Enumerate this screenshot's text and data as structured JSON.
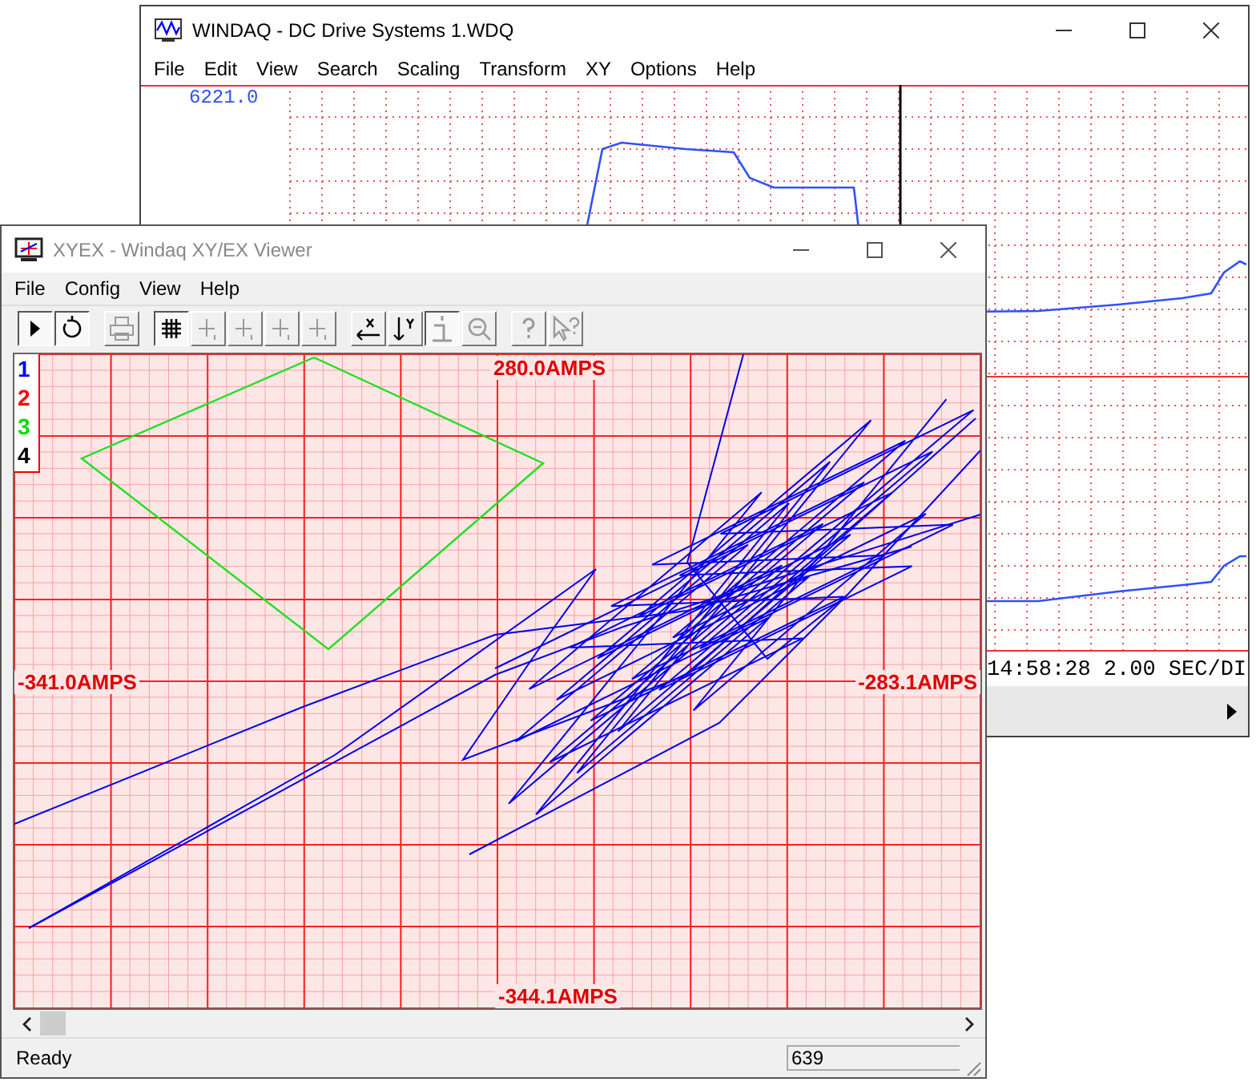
{
  "back_window": {
    "title": "WINDAQ - DC Drive Systems 1.WDQ",
    "active": true,
    "menu": [
      "File",
      "Edit",
      "View",
      "Search",
      "Scaling",
      "Transform",
      "XY",
      "Options",
      "Help"
    ],
    "scale_label": "6221.0",
    "time_label": "14:58:28 2.00 SEC/DI"
  },
  "front_window": {
    "title": "XYEX - Windaq XY/EX Viewer",
    "active": false,
    "menu": [
      "File",
      "Config",
      "View",
      "Help"
    ],
    "toolbar": [
      [
        {
          "kind": "play",
          "pressed": true,
          "disabled": false
        },
        {
          "kind": "reset",
          "pressed": true,
          "disabled": false
        }
      ],
      [
        {
          "kind": "print",
          "pressed": false,
          "disabled": true
        }
      ],
      [
        {
          "kind": "grid",
          "pressed": true,
          "disabled": false
        },
        {
          "kind": "cursor",
          "pressed": false,
          "disabled": true
        },
        {
          "kind": "cursor",
          "pressed": false,
          "disabled": true
        },
        {
          "kind": "cursor",
          "pressed": false,
          "disabled": true
        },
        {
          "kind": "cursor",
          "pressed": false,
          "disabled": true
        }
      ],
      [
        {
          "kind": "x-axis",
          "pressed": false,
          "disabled": false
        },
        {
          "kind": "y-axis",
          "pressed": false,
          "disabled": false
        },
        {
          "kind": "info",
          "pressed": true,
          "disabled": true
        },
        {
          "kind": "zoom",
          "pressed": false,
          "disabled": true
        }
      ],
      [
        {
          "kind": "help",
          "pressed": false,
          "disabled": true
        },
        {
          "kind": "context-help",
          "pressed": false,
          "disabled": true
        }
      ]
    ],
    "legend": [
      {
        "label": "1",
        "color": "#0000ff"
      },
      {
        "label": "2",
        "color": "#ff0000"
      },
      {
        "label": "3",
        "color": "#00dd00"
      },
      {
        "label": "4",
        "color": "#000000"
      }
    ],
    "axis_labels": {
      "top": "280.0AMPS",
      "left": "-341.0AMPS",
      "right": "-283.1AMPS",
      "bottom": "-344.1AMPS"
    },
    "status": {
      "text": "Ready",
      "count": "639"
    }
  }
}
